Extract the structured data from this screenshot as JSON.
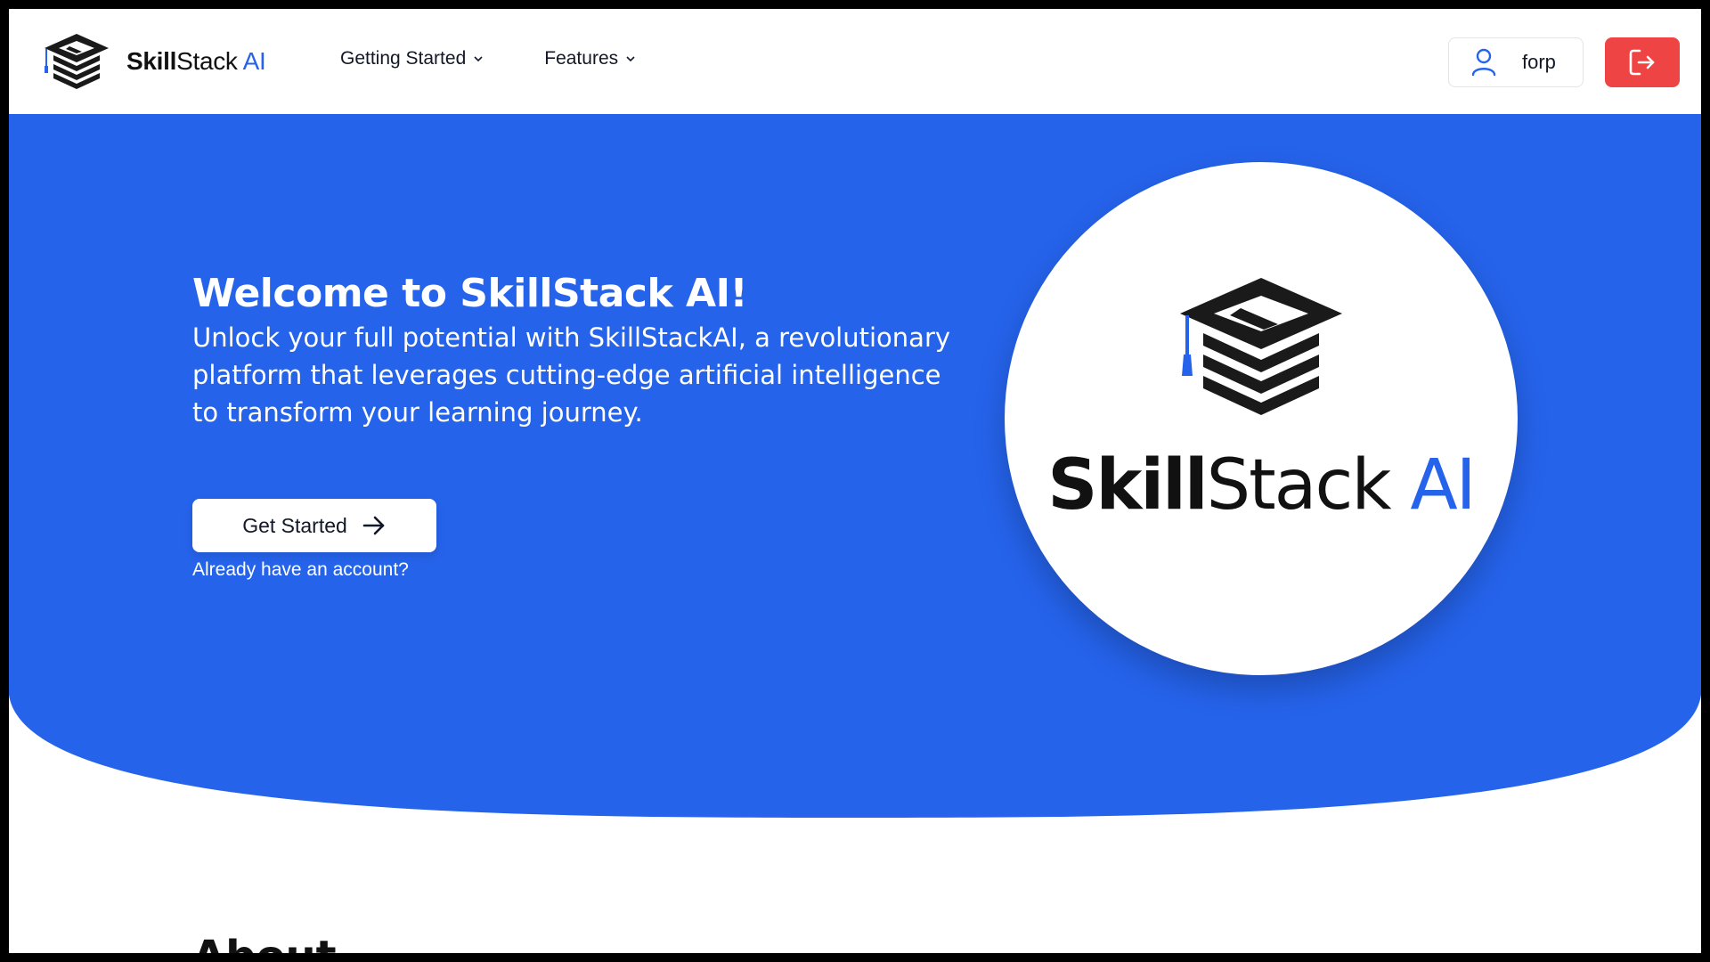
{
  "brand": {
    "name_bold": "Skill",
    "name_thin": "Stack",
    "name_accent": "AI",
    "icon": "graduation-cap-stack-icon"
  },
  "nav": {
    "items": [
      {
        "label": "Getting Started",
        "icon": "chevron-down-icon"
      },
      {
        "label": "Features",
        "icon": "chevron-down-icon"
      }
    ]
  },
  "user": {
    "name": "forp",
    "icon": "user-icon"
  },
  "logout": {
    "icon": "logout-icon"
  },
  "hero": {
    "title": "Welcome to SkillStack AI!",
    "subtitle": "Unlock your full potential with SkillStackAI, a revolutionary platform that leverages cutting-edge artificial intelligence to transform your learning journey.",
    "cta_label": "Get Started",
    "cta_icon": "arrow-right-icon",
    "signin_link": "Already have an account?"
  },
  "hero_logo": {
    "name_bold": "Skill",
    "name_thin": "Stack",
    "name_accent": "AI"
  },
  "about": {
    "heading": "About"
  },
  "colors": {
    "primary": "#2563eb",
    "danger": "#ef4444",
    "background": "#ffffff",
    "text": "#111827"
  }
}
